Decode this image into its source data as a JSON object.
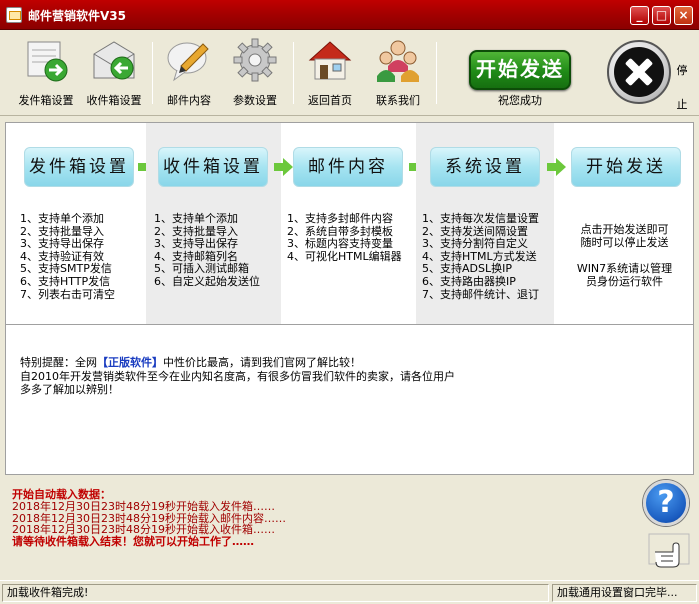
{
  "window": {
    "title": "邮件营销软件V35",
    "min_glyph": "_",
    "max_glyph": "□",
    "close_glyph": "×"
  },
  "toolbar": {
    "items": [
      {
        "label": "发件箱设置",
        "icon": "outbox-envelope-icon"
      },
      {
        "label": "收件箱设置",
        "icon": "inbox-envelope-icon"
      },
      {
        "label": "邮件内容",
        "icon": "pen-speech-bubble-icon"
      },
      {
        "label": "参数设置",
        "icon": "gear-icon"
      },
      {
        "label": "返回首页",
        "icon": "house-icon"
      },
      {
        "label": "联系我们",
        "icon": "people-group-icon"
      }
    ],
    "start_label": "开始发送",
    "start_caption": "祝您成功",
    "stop_label": "停止"
  },
  "steps": [
    {
      "title": "发件箱设置",
      "features": [
        "1、支持单个添加",
        "2、支持批量导入",
        "3、支持导出保存",
        "4、支持验证有效",
        "5、支持SMTP发信",
        "6、支持HTTP发信",
        "7、列表右击可清空"
      ]
    },
    {
      "title": "收件箱设置",
      "features": [
        "1、支持单个添加",
        "2、支持批量导入",
        "3、支持导出保存",
        "4、支持邮箱列名",
        "5、可插入测试邮箱",
        "6、自定义起始发送位"
      ]
    },
    {
      "title": "邮件内容",
      "features": [
        "1、支持多封邮件内容",
        "2、系统自带多封模板",
        "3、标题内容支持变量",
        "4、可视化HTML编辑器"
      ]
    },
    {
      "title": "系统设置",
      "features": [
        "1、支持每次发信量设置",
        "2、支持发送间隔设置",
        "3、支持分割符自定义",
        "4、支持HTML方式发送",
        "5、支持ADSL换IP",
        "6、支持路由器换IP",
        "7、支持邮件统计、退订"
      ]
    },
    {
      "title": "开始发送",
      "notes": [
        "点击开始发送即可",
        "随时可以停止发送",
        "",
        "WIN7系统请以管理",
        "员身份运行软件"
      ]
    }
  ],
  "notice": {
    "line1_a": "特别提醒：全网",
    "line1_highlight": "【正版软件】",
    "line1_b": "中性价比最高，请到我们官网了解比较！",
    "line2": "自2010年开发营销类软件至今在业内知名度高，有很多仿冒我们软件的卖家，请各位用户",
    "line3": "多多了解加以辨别！"
  },
  "log": [
    "开始自动载入数据：",
    "2018年12月30日23时48分19秒开始载入发件箱……",
    "2018年12月30日23时48分19秒开始载入邮件内容……",
    "2018年12月30日23时48分19秒开始载入收件箱……",
    "请等待收件箱载入结束！您就可以开始工作了……"
  ],
  "help_glyph": "?",
  "status": {
    "left": "加载收件箱完成!",
    "right": "加载通用设置窗口完毕..."
  }
}
